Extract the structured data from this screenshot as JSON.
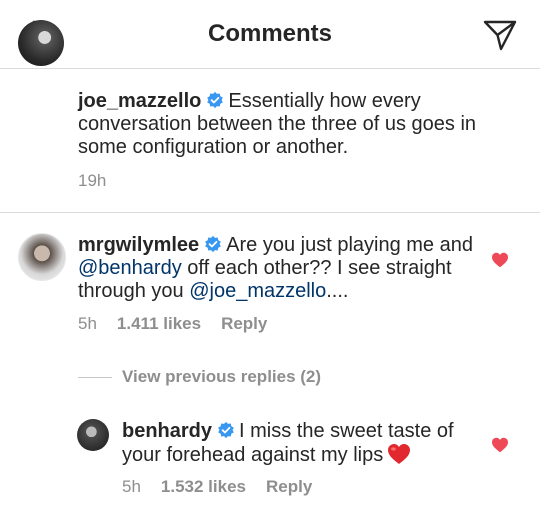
{
  "header": {
    "title": "Comments"
  },
  "caption": {
    "username": "joe_mazzello",
    "text": "Essentially how every conversation between the three of us goes in some configuration or another.",
    "time": "19h"
  },
  "comments": [
    {
      "username": "mrgwilymlee",
      "text_a": "Are you just playing me and ",
      "mention_1": "@benhardy",
      "text_b": " off each other?? I see straight through you ",
      "mention_2": "@joe_mazzello",
      "text_c": "....",
      "time": "5h",
      "likes": "1.411 likes",
      "reply": "Reply",
      "liked": true,
      "view_previous": "View previous replies (2)"
    },
    {
      "username": "benhardy",
      "text": "I miss the sweet taste of your forehead against my lips",
      "emoji": "red-heart",
      "time": "5h",
      "likes": "1.532 likes",
      "reply": "Reply",
      "liked": true
    }
  ],
  "colors": {
    "verified": "#3897f0",
    "like_heart": "#ed4956",
    "mention": "#003569",
    "muted": "#8e8e8e"
  },
  "icons": [
    "back-arrow-icon",
    "direct-send-icon",
    "verified-badge-icon",
    "heart-icon",
    "red-heart-emoji"
  ]
}
